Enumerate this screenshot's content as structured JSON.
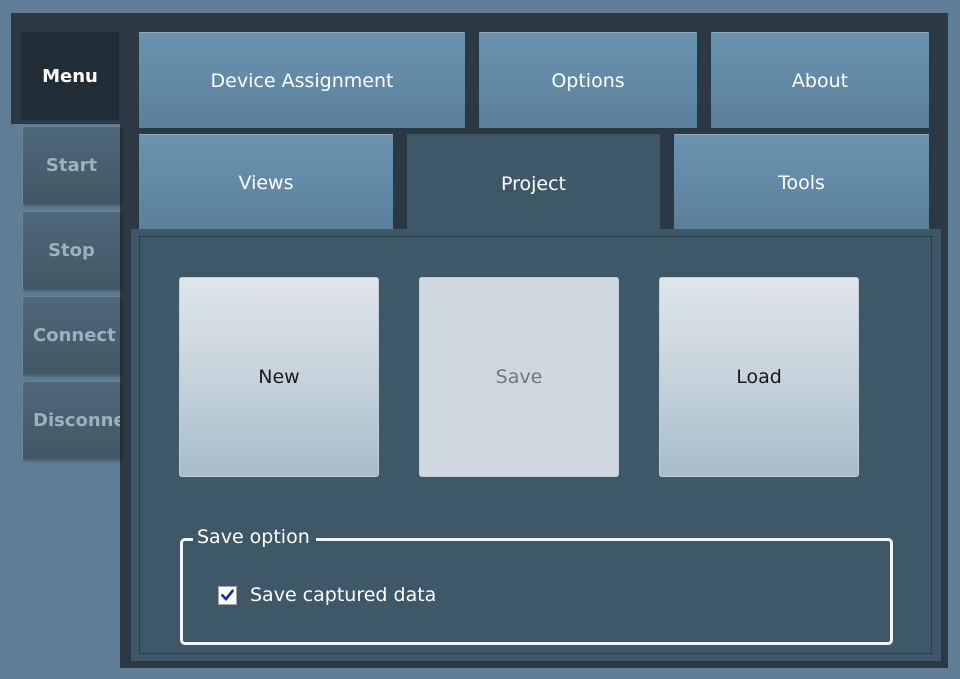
{
  "sidebar": {
    "menu_label": "Menu",
    "items": [
      {
        "label": "Start"
      },
      {
        "label": "Stop"
      },
      {
        "label": "Connect"
      },
      {
        "label": "Disconnect"
      }
    ]
  },
  "tabs": {
    "row1": [
      {
        "label": "Device Assignment"
      },
      {
        "label": "Options"
      },
      {
        "label": "About"
      }
    ],
    "row2": [
      {
        "label": "Views"
      },
      {
        "label": "Project",
        "active": true
      },
      {
        "label": "Tools"
      }
    ]
  },
  "project": {
    "new_label": "New",
    "save_label": "Save",
    "save_enabled": false,
    "load_label": "Load",
    "save_option": {
      "title": "Save option",
      "checkbox_label": "Save captured data",
      "checked": true
    }
  },
  "colors": {
    "background": "#5f7e96",
    "frame": "#2c3944",
    "panel": "#3f5868",
    "tab": "#6a93b0",
    "check_mark": "#1f2a9c"
  }
}
